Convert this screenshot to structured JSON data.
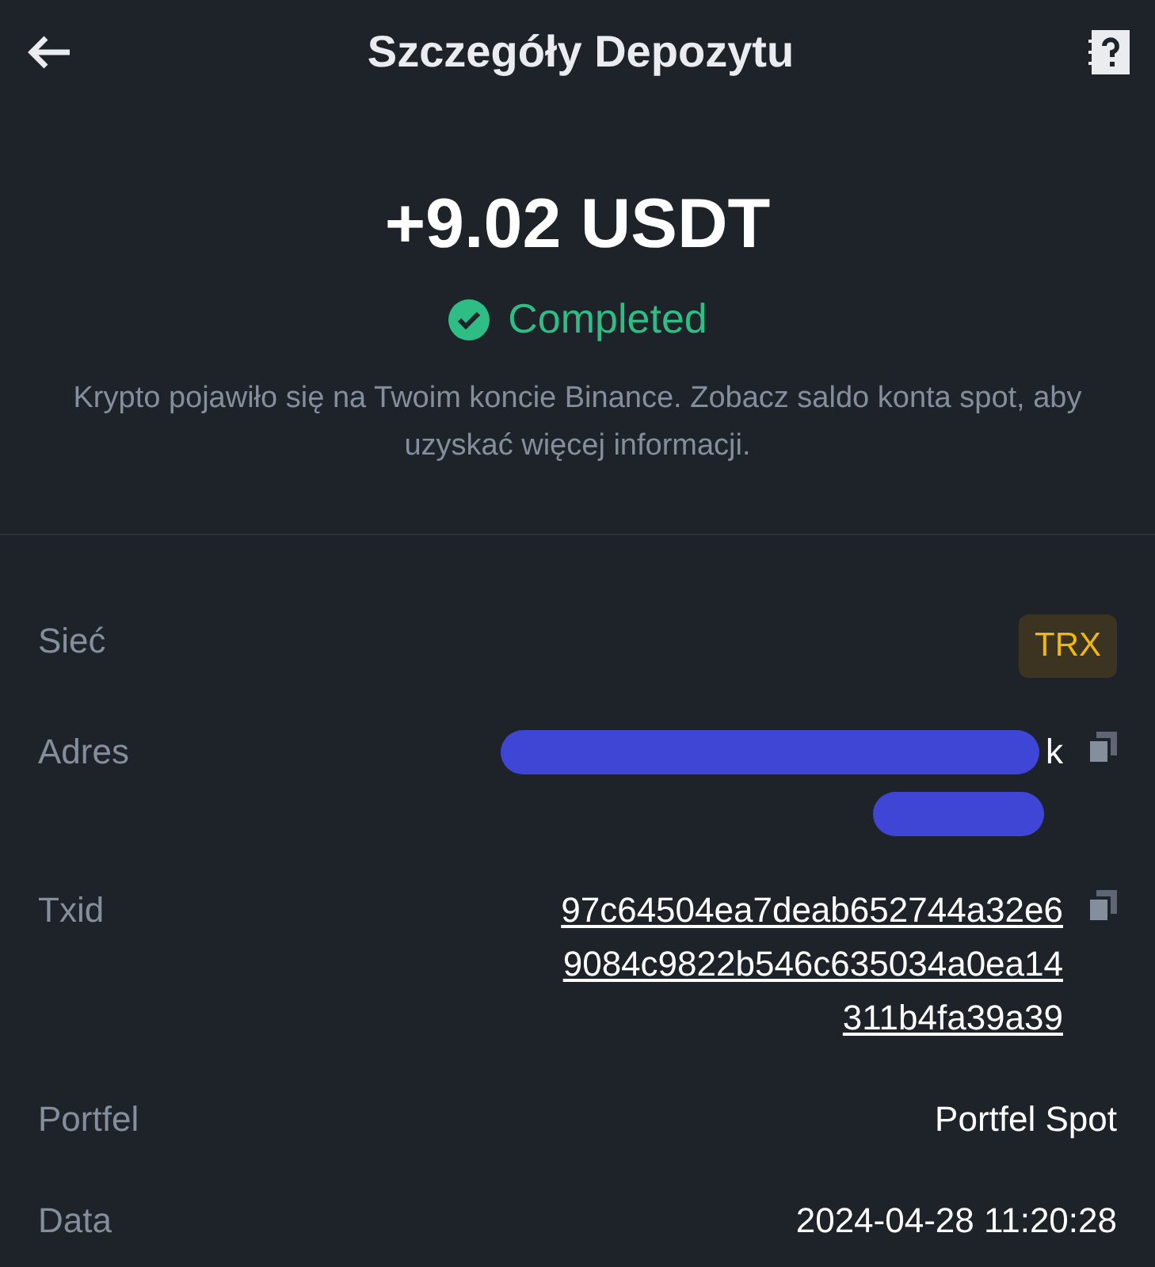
{
  "header": {
    "title": "Szczegóły Depozytu"
  },
  "amount": "+9.02 USDT",
  "status": {
    "label": "Completed",
    "kind": "completed"
  },
  "description": "Krypto pojawiło się na Twoim koncie Binance. Zobacz saldo konta spot, aby uzyskać więcej informacji.",
  "details": [
    {
      "label": "Sieć",
      "kind": "badge",
      "value": "TRX"
    },
    {
      "label": "Adres",
      "kind": "redacted",
      "value": "k",
      "copyable": true
    },
    {
      "label": "Txid",
      "kind": "link",
      "lines": [
        "97c64504ea7deab652744a32e6",
        "9084c9822b546c635034a0ea14",
        "311b4fa39a39"
      ],
      "copyable": true
    },
    {
      "label": "Portfel",
      "kind": "text",
      "value": "Portfel Spot"
    },
    {
      "label": "Data",
      "kind": "text",
      "value": "2024-04-28 11:20:28"
    }
  ]
}
